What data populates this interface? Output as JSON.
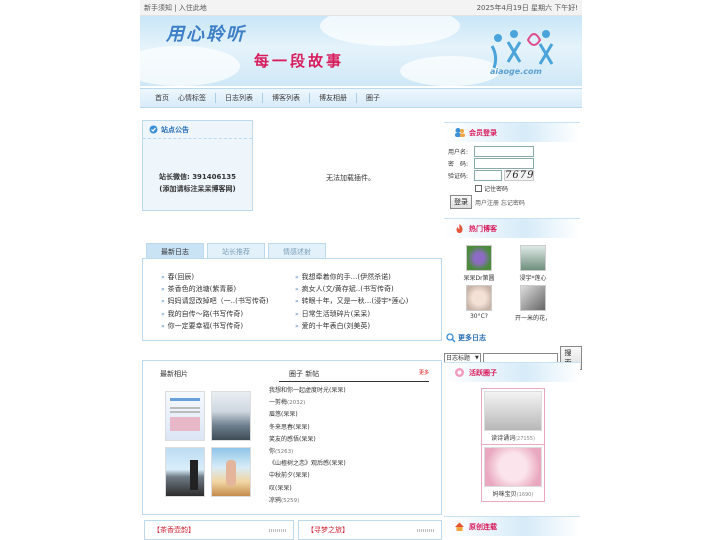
{
  "topbar": {
    "left": "新手须知 | 入住此地",
    "right": "2025年4月19日 星期六 下午好!"
  },
  "banner": {
    "slogan1": "用心聆听",
    "slogan2": "每一段故事",
    "logo_text": "aiaoge.com"
  },
  "nav": {
    "items": [
      "首页",
      "心情标签",
      "日志列表",
      "博客列表",
      "博友相册",
      "圈子"
    ]
  },
  "notice": {
    "title": "站点公告",
    "line1": "站长微信: 391406135",
    "line2": "(添加请标注呆呆博客网)"
  },
  "plugin": {
    "text": "无法加载插件。"
  },
  "tabs": {
    "items": [
      "最新日志",
      "站长推荐",
      "情感述射"
    ],
    "left_list": [
      "春(回辰)",
      "茶香色的池塘(紫青藤)",
      "妈妈请您改掉吧（一..(书写传奇)",
      "我的自传〜路(书写传奇)",
      "你一定要幸福(书写传奇)"
    ],
    "right_list": [
      "我想牵着你的手...(伊然杀诺)",
      "疯女人(文/黄存斌..(书写传奇)",
      "转眼十年，又是一秋...(浸宇*莲心)",
      "日常生活琐碎片(呆呆)",
      "爱的十年表白(刘美英)"
    ]
  },
  "photos": {
    "title": "最新相片"
  },
  "circle": {
    "title": "圈子 新帖",
    "more": "更多",
    "items": [
      {
        "t": "我想和你一起虚度时光(呆呆)",
        "n": ""
      },
      {
        "t": "一剪梅",
        "n": "(2032)"
      },
      {
        "t": "眉悠(呆呆)",
        "n": ""
      },
      {
        "t": "冬来思春(呆呆)",
        "n": ""
      },
      {
        "t": "笑友的感悟(呆呆)",
        "n": ""
      },
      {
        "t": "你",
        "n": "(5263)"
      },
      {
        "t": "《山楂树之恋》观后感(呆呆)",
        "n": ""
      },
      {
        "t": "中秋前夕(呆呆)",
        "n": ""
      },
      {
        "t": "叹(呆呆)",
        "n": ""
      },
      {
        "t": "凉鸦",
        "n": "(5259)"
      }
    ]
  },
  "bottom": {
    "left": "【茶香壶韵】",
    "right": "【寻梦之旅】"
  },
  "login": {
    "title": "会员登录",
    "user_label": "用户名:",
    "pass_label": "密　码:",
    "code_label": "验证码:",
    "captcha": "7679",
    "remember": "记住密码",
    "login_btn": "登录",
    "links": "用户注册 忘记密码"
  },
  "hot": {
    "title": "热门博客",
    "users": [
      "呆呆Dr第圆",
      "浸宇*莲心",
      "30°C?",
      "开一米的花，"
    ]
  },
  "more_logs": {
    "title": "更多日志",
    "select": "日志标题",
    "search_btn": "搜索"
  },
  "active": {
    "title": "活跃圈子",
    "items": [
      {
        "name": "读诗诵词",
        "n": "(27155)"
      },
      {
        "name": "妈咪宝贝",
        "n": "(1690)"
      }
    ]
  },
  "newpost": {
    "title": "原创连载"
  }
}
